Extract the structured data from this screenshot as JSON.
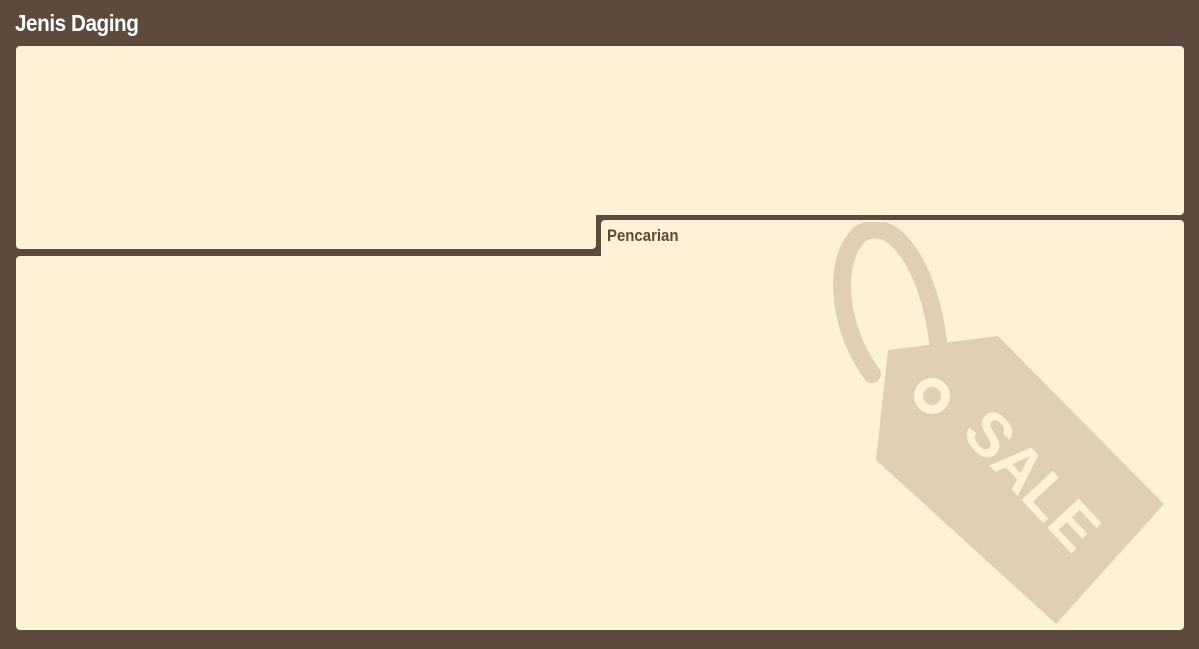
{
  "header": {
    "title": "Jenis Daging"
  },
  "search": {
    "label": "Pencarian"
  },
  "decoration": {
    "tag_text": "SALE",
    "tag_color": "#dfd0b4",
    "panel_color": "#fdf2d6",
    "frame_color": "#5c4b3d"
  }
}
